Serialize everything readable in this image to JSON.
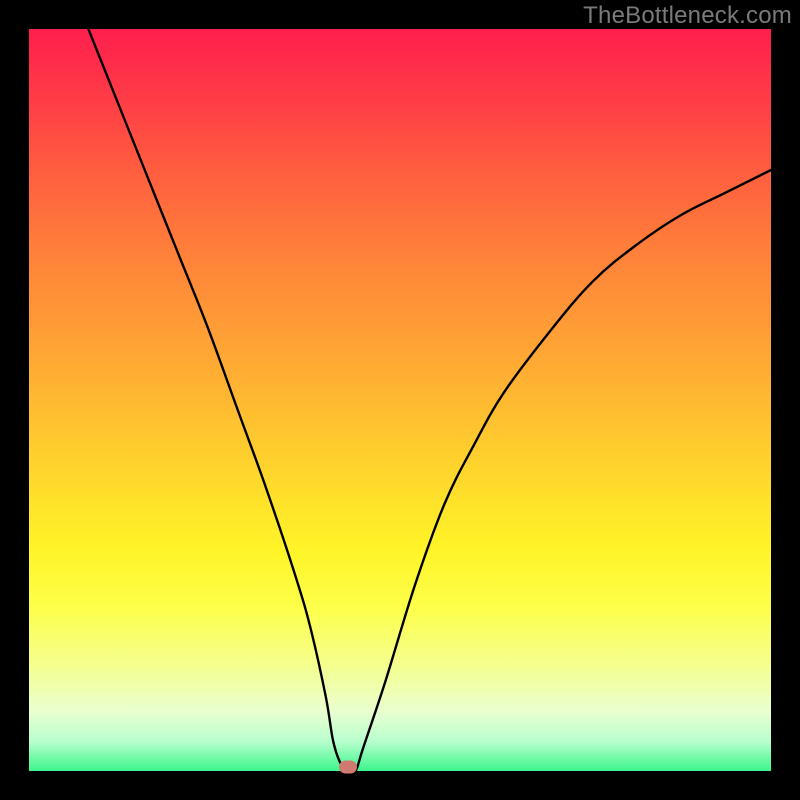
{
  "watermark": "TheBottleneck.com",
  "colors": {
    "frame": "#000000",
    "watermark": "#7a7a7a",
    "curve": "#000000",
    "marker": "#cf7a70"
  },
  "chart_data": {
    "type": "line",
    "title": "",
    "xlabel": "",
    "ylabel": "",
    "xlim": [
      0,
      100
    ],
    "ylim": [
      0,
      100
    ],
    "grid": false,
    "legend": false,
    "series": [
      {
        "name": "bottleneck-curve",
        "x": [
          8,
          12,
          16,
          20,
          24,
          28,
          32,
          36,
          38,
          40,
          41,
          42,
          43,
          44,
          45,
          48,
          52,
          56,
          60,
          64,
          70,
          76,
          82,
          88,
          94,
          100
        ],
        "values": [
          100,
          90,
          80,
          70,
          60,
          49,
          38,
          26,
          19,
          10,
          4,
          1,
          0,
          0,
          3,
          12,
          25,
          36,
          44,
          51,
          59,
          66,
          71,
          75,
          78,
          81
        ]
      }
    ],
    "marker": {
      "x": 43,
      "y": 0
    },
    "gradient_stops": [
      {
        "pct": 0,
        "color": "#ff1f4d"
      },
      {
        "pct": 18,
        "color": "#ff5a40"
      },
      {
        "pct": 44,
        "color": "#ffa734"
      },
      {
        "pct": 70,
        "color": "#fff427"
      },
      {
        "pct": 92,
        "color": "#e9ffd0"
      },
      {
        "pct": 100,
        "color": "#3cf58b"
      }
    ]
  }
}
